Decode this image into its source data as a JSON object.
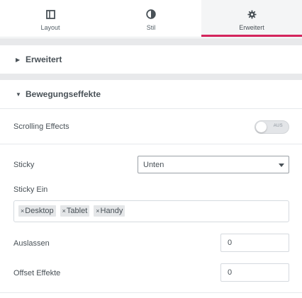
{
  "tabs": [
    {
      "label": "Layout",
      "icon": "layout-icon",
      "active": false
    },
    {
      "label": "Stil",
      "icon": "half-circle-icon",
      "active": false
    },
    {
      "label": "Erweitert",
      "icon": "gear-icon",
      "active": true
    }
  ],
  "sections": {
    "advanced": {
      "title": "Erweitert",
      "collapsed": true
    },
    "motion": {
      "title": "Bewegungseffekte",
      "collapsed": false
    }
  },
  "fields": {
    "scrolling_effects": {
      "label": "Scrolling Effects",
      "toggle_text": "AUS",
      "value": false
    },
    "sticky": {
      "label": "Sticky",
      "selected": "Unten"
    },
    "sticky_on": {
      "label": "Sticky Ein",
      "tags": [
        "Desktop",
        "Tablet",
        "Handy"
      ],
      "remove_glyph": "×"
    },
    "exclude": {
      "label": "Auslassen",
      "value": "0"
    },
    "offset_effects": {
      "label": "Offset Effekte",
      "value": "0"
    }
  },
  "colors": {
    "accent": "#d5255d",
    "band": "#e8e9eb",
    "text": "#495157"
  }
}
